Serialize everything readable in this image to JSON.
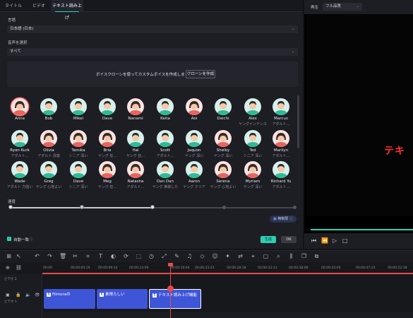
{
  "tabs": [
    "タイトル",
    "ビデオ",
    "テキスト読み上げ"
  ],
  "language": {
    "label": "言語",
    "value": "日本語 (日本)"
  },
  "voice_select": {
    "label": "音声を選択",
    "value": "すべて"
  },
  "banner": {
    "text": "ボイスクローンを使ってカスタムボイスを作成しましょう!",
    "badge": "New",
    "button": "クローンを作成"
  },
  "voices": [
    {
      "name": "Anna",
      "sub": "",
      "gender": "f",
      "selected": true
    },
    {
      "name": "Bob",
      "sub": "",
      "gender": "m"
    },
    {
      "name": "Mikel",
      "sub": "",
      "gender": "m"
    },
    {
      "name": "Dave",
      "sub": "",
      "gender": "m"
    },
    {
      "name": "Nanami",
      "sub": "",
      "gender": "f"
    },
    {
      "name": "Keita",
      "sub": "",
      "gender": "m"
    },
    {
      "name": "Aoi",
      "sub": "",
      "gender": "f"
    },
    {
      "name": "Daichi",
      "sub": "",
      "gender": "m"
    },
    {
      "name": "Alex",
      "sub": "ヤングインテンス",
      "gender": "m"
    },
    {
      "name": "Marcus",
      "sub": "アダルト...",
      "gender": "m"
    },
    {
      "name": "Ryan Kurk",
      "sub": "アダルト...",
      "gender": "m"
    },
    {
      "name": "Olivia",
      "sub": "アダルト 清楚",
      "gender": "f"
    },
    {
      "name": "Tamika",
      "sub": "シニア 深い",
      "gender": "f"
    },
    {
      "name": "Bria",
      "sub": "ヤング 狂...",
      "gender": "f"
    },
    {
      "name": "Hal",
      "sub": "ヤング 狂...",
      "gender": "m"
    },
    {
      "name": "Scott",
      "sub": "アダルト...",
      "gender": "m"
    },
    {
      "name": "Jaquon",
      "sub": "ヤング 深い",
      "gender": "m"
    },
    {
      "name": "Shelby",
      "sub": "ヤング 深い",
      "gender": "f"
    },
    {
      "name": "Ted",
      "sub": "シニア 深い",
      "gender": "m"
    },
    {
      "name": "Marilyn",
      "sub": "アダルト...",
      "gender": "f"
    },
    {
      "name": "Wade",
      "sub": "アダルト 力強い",
      "gender": "m"
    },
    {
      "name": "Greg",
      "sub": "ヤング 心地よい",
      "gender": "m"
    },
    {
      "name": "Dave",
      "sub": "シニア 深い",
      "gender": "m"
    },
    {
      "name": "Meg",
      "sub": "ヤング 狂...",
      "gender": "f"
    },
    {
      "name": "Natasha",
      "sub": "アダルト...",
      "gender": "f"
    },
    {
      "name": "Dan Dan",
      "sub": "ヤング 鼻歌した",
      "gender": "m"
    },
    {
      "name": "Aaron",
      "sub": "ヤング クリア",
      "gender": "m"
    },
    {
      "name": "Serena",
      "sub": "ヤング 心地よい",
      "gender": "f"
    },
    {
      "name": "Myriam",
      "sub": "ヤング 深い",
      "gender": "f"
    },
    {
      "name": "Richard Yu",
      "sub": "アダルト...",
      "gender": "m"
    }
  ],
  "speed": {
    "label": "速度",
    "level": 0.5
  },
  "free_badge": "無制限",
  "auto_match": {
    "label": "自動一致",
    "checked": true
  },
  "generate_label": "生成",
  "ok_label": "OK",
  "preview": {
    "play_label": "再生",
    "quality": "フル品質",
    "text": "テキ"
  },
  "ruler_times": [
    "00:00",
    "00:00:04:19",
    "00:00:09:14",
    "00:00:14:09",
    "00:00:19:04",
    "00:00:23:23",
    "00:00:28:18",
    "00:00:33:13",
    "00:00:38:08",
    "00:00:43:04",
    "00:00:47:23",
    "00:00:52:18"
  ],
  "clips": [
    "Filmoraの",
    "素晴らしい",
    "テキスト読み上げ機能"
  ],
  "track_labels": {
    "video": "ビデオ 2",
    "video1": "ビデオ 1"
  },
  "colors": {
    "accent": "#2fd4b5",
    "playhead": "#e94a4a",
    "clip": "#3f55d8",
    "preview_text": "#ff2f2f"
  }
}
